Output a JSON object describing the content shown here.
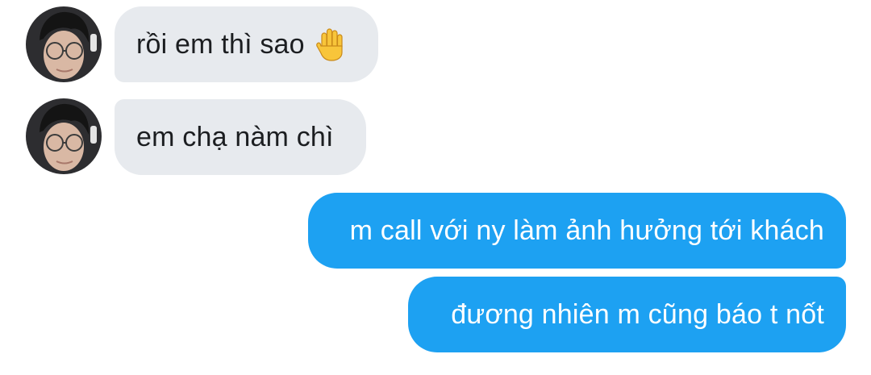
{
  "conversation": {
    "messages": [
      {
        "direction": "incoming",
        "text": "rồi em thì sao",
        "emoji_icon": "raised-hand-icon"
      },
      {
        "direction": "incoming",
        "text": "em chạ nàm chì"
      },
      {
        "direction": "outgoing",
        "text": "m call với ny làm ảnh hưởng tới khách"
      },
      {
        "direction": "outgoing",
        "text": "đương nhiên m cũng báo t nốt"
      }
    ]
  },
  "colors": {
    "incoming_bubble": "#e7eaee",
    "incoming_text": "#1c1e21",
    "outgoing_bubble": "#1da1f2",
    "outgoing_text": "#ffffff",
    "emoji_hand": "#f8c53a"
  }
}
